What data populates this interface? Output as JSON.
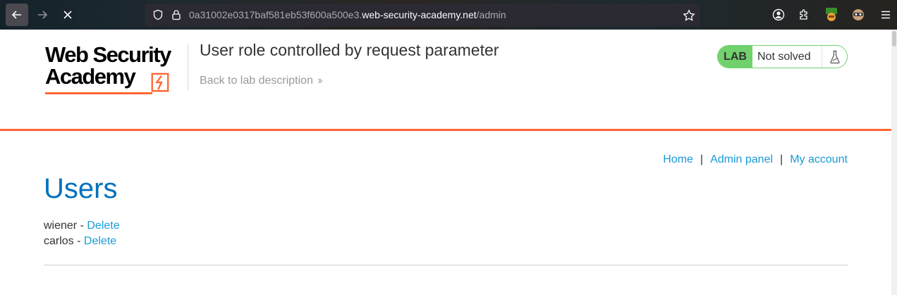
{
  "browser": {
    "url_host_prefix": "0a31002e0317baf581eb53f600a500e3.",
    "url_domain": "web-security-academy.net",
    "url_path": "/admin"
  },
  "header": {
    "logo_line1": "Web Security",
    "logo_line2": "Academy",
    "lab_title": "User role controlled by request parameter",
    "back_link": "Back to lab description",
    "badge_lab": "LAB",
    "badge_status": "Not solved"
  },
  "nav": {
    "links": [
      "Home",
      "Admin panel",
      "My account"
    ],
    "separator": "|"
  },
  "main": {
    "heading": "Users",
    "users": [
      {
        "name": "wiener",
        "sep": " - ",
        "action": "Delete"
      },
      {
        "name": "carlos",
        "sep": " - ",
        "action": "Delete"
      }
    ]
  },
  "colors": {
    "accent_orange": "#ff6633",
    "link_blue": "#1b9ad6",
    "heading_blue": "#0071bc",
    "lab_green": "#70d16d"
  },
  "icons": [
    "back-arrow-icon",
    "forward-arrow-icon",
    "stop-icon",
    "shield-icon",
    "lock-icon",
    "star-icon",
    "account-icon",
    "extensions-icon",
    "burp-icon",
    "mask-icon",
    "menu-icon",
    "flask-icon",
    "double-chevron-icon"
  ]
}
